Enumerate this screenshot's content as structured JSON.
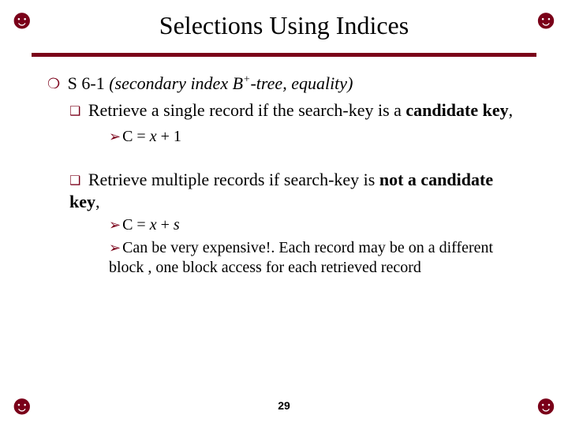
{
  "corner_glyph": "☻",
  "title": "Selections Using Indices",
  "main_bullet": {
    "label": "S 6-1",
    "desc_pre": " (secondary index B",
    "desc_sup": "+",
    "desc_post": "-tree, equality)"
  },
  "sub1": {
    "lead": "Retrieve",
    "mid": " a single record if the search-key is a ",
    "bold": "candidate key",
    "tail": ","
  },
  "cost1": {
    "pre": "C = ",
    "var": "x",
    "post": " + 1"
  },
  "sub2": {
    "lead": "Retrieve",
    "mid": " multiple records if search-key is ",
    "bold": "not a candidate key",
    "tail": ","
  },
  "cost2": {
    "pre": "C = ",
    "var1": "x",
    "mid": " + ",
    "var2": "s"
  },
  "note": "Can be very expensive!. Each record may be on a different block , one block access for each retrieved record",
  "page_number": "29"
}
